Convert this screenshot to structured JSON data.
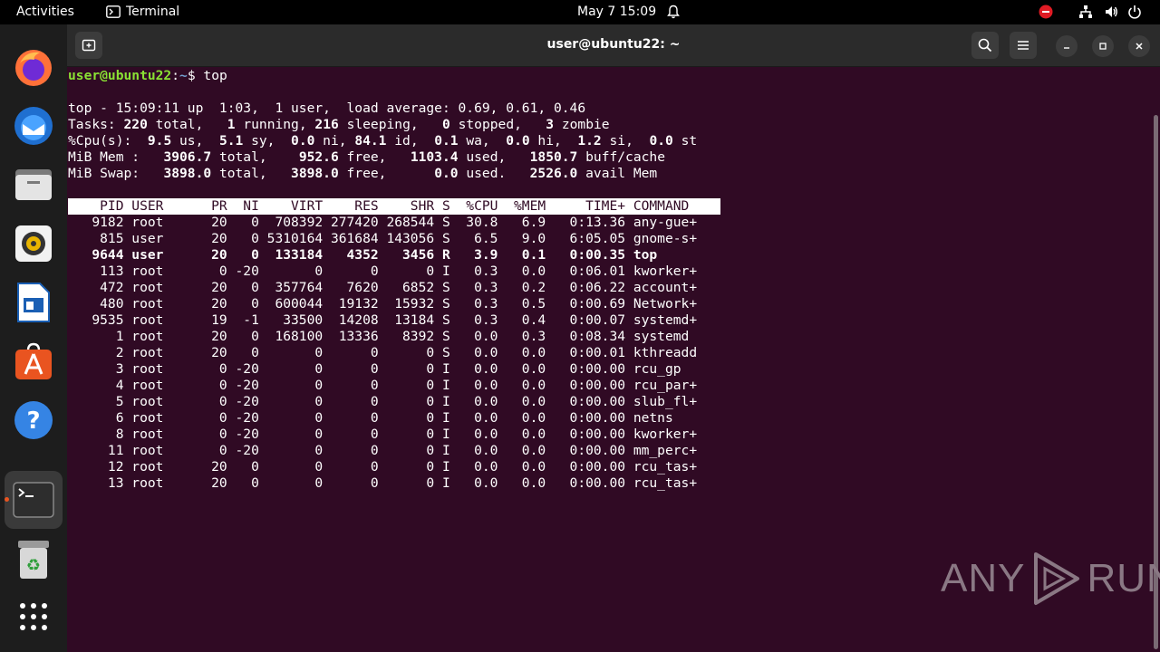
{
  "topbar": {
    "activities": "Activities",
    "app_name": "Terminal",
    "clock": "May 7  15:09"
  },
  "dock": {
    "items": [
      "firefox-icon",
      "thunderbird-icon",
      "files-icon",
      "rhythmbox-icon",
      "libreoffice-writer-icon",
      "app-center-icon",
      "help-icon",
      "terminal-icon",
      "trash-icon",
      "show-apps-icon"
    ]
  },
  "window": {
    "title": "user@ubuntu22: ~"
  },
  "terminal": {
    "prompt": {
      "user": "user@ubuntu22",
      "sep": ":",
      "path": "~",
      "sym": "$ ",
      "command": "top"
    },
    "summary": {
      "l1": "top - 15:09:11 up  1:03,  1 user,  load average: 0.69, 0.61, 0.46",
      "tasks": [
        "Tasks: ",
        "220",
        " total,   ",
        "1",
        " running, ",
        "216",
        " sleeping,   ",
        "0",
        " stopped,   ",
        "3",
        " zombie"
      ],
      "cpu": [
        "%Cpu(s):  ",
        "9.5",
        " us,  ",
        "5.1",
        " sy,  ",
        "0.0",
        " ni, ",
        "84.1",
        " id,  ",
        "0.1",
        " wa,  ",
        "0.0",
        " hi,  ",
        "1.2",
        " si,  ",
        "0.0",
        " st"
      ],
      "mem": [
        "MiB Mem :   ",
        "3906.7",
        " total,    ",
        "952.6",
        " free,   ",
        "1103.4",
        " used,   ",
        "1850.7",
        " buff/cache"
      ],
      "swap": [
        "MiB Swap:   ",
        "3898.0",
        " total,   ",
        "3898.0",
        " free,      ",
        "0.0",
        " used.   ",
        "2526.0",
        " avail Mem"
      ]
    },
    "header": "    PID USER      PR  NI    VIRT    RES    SHR S  %CPU  %MEM     TIME+ COMMAND",
    "rows": [
      "   9182 root      20   0  708392 277420 268544 S  30.8   6.9   0:13.36 any-gue+",
      "    815 user      20   0 5310164 361684 143056 S   6.5   9.0   6:05.05 gnome-s+",
      "   9644 user      20   0  133184   4352   3456 R   3.9   0.1   0:00.35 top",
      "    113 root       0 -20       0      0      0 I   0.3   0.0   0:06.01 kworker+",
      "    472 root      20   0  357764   7620   6852 S   0.3   0.2   0:06.22 account+",
      "    480 root      20   0  600044  19132  15932 S   0.3   0.5   0:00.69 Network+",
      "   9535 root      19  -1   33500  14208  13184 S   0.3   0.4   0:00.07 systemd+",
      "      1 root      20   0  168100  13336   8392 S   0.0   0.3   0:08.34 systemd",
      "      2 root      20   0       0      0      0 S   0.0   0.0   0:00.01 kthreadd",
      "      3 root       0 -20       0      0      0 I   0.0   0.0   0:00.00 rcu_gp",
      "      4 root       0 -20       0      0      0 I   0.0   0.0   0:00.00 rcu_par+",
      "      5 root       0 -20       0      0      0 I   0.0   0.0   0:00.00 slub_fl+",
      "      6 root       0 -20       0      0      0 I   0.0   0.0   0:00.00 netns",
      "      8 root       0 -20       0      0      0 I   0.0   0.0   0:00.00 kworker+",
      "     11 root       0 -20       0      0      0 I   0.0   0.0   0:00.00 mm_perc+",
      "     12 root      20   0       0      0      0 I   0.0   0.0   0:00.00 rcu_tas+",
      "     13 root      20   0       0      0      0 I   0.0   0.0   0:00.00 rcu_tas+"
    ]
  },
  "watermark": {
    "left": "ANY",
    "right": "RUN"
  }
}
